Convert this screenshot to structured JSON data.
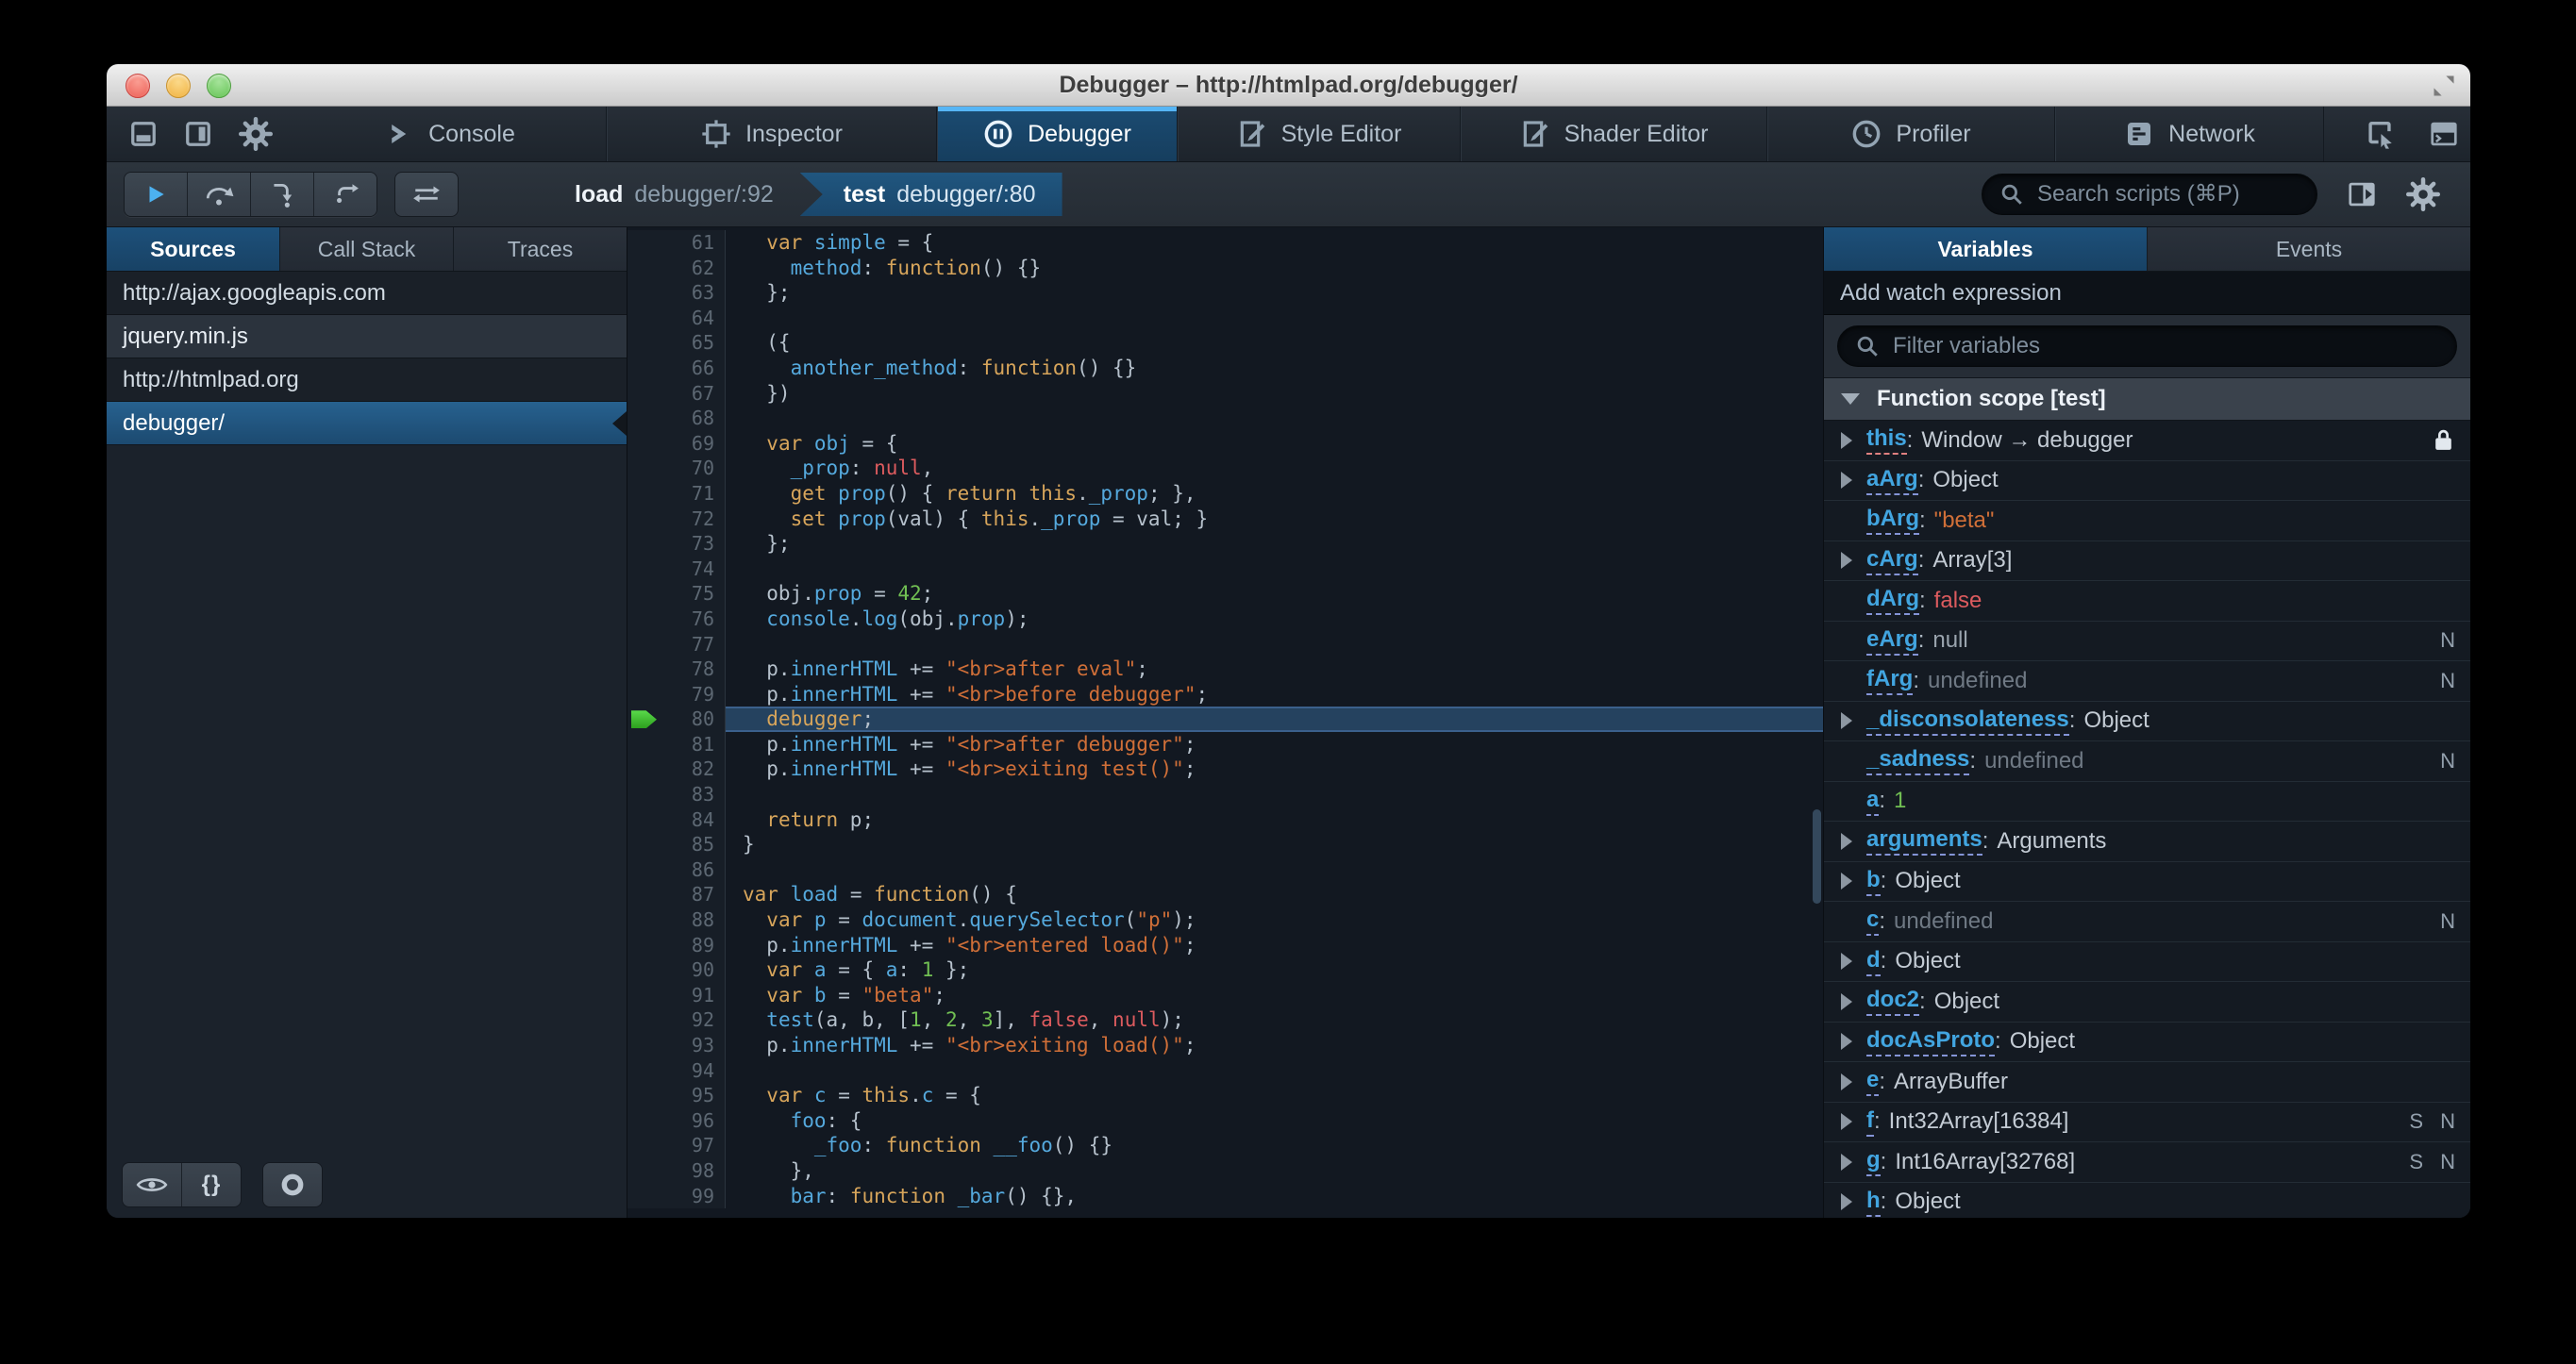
{
  "window": {
    "title": "Debugger – http://htmlpad.org/debugger/"
  },
  "theme": {
    "accent_blue": "#46afe3",
    "selection_blue": "#1d4f73",
    "chrome_dark": "#252c33",
    "editor_bg": "#121821",
    "keyword": "#d7a55b",
    "identifier": "#55a9dd",
    "string": "#d06f38",
    "number": "#71bf53",
    "atom": "#dc5b5e",
    "exec_arrow_green": "#3dbb2d"
  },
  "tabbar": {
    "dock_icons": [
      {
        "icon": "dock-bottom-icon"
      },
      {
        "icon": "dock-side-icon"
      },
      {
        "icon": "toolbox-options-gear-icon"
      }
    ],
    "tabs": [
      {
        "label": "Console",
        "icon": "console-icon",
        "active": false
      },
      {
        "label": "Inspector",
        "icon": "inspector-icon",
        "active": false
      },
      {
        "label": "Debugger",
        "icon": "debugger-icon",
        "active": true
      },
      {
        "label": "Style Editor",
        "icon": "style-editor-icon",
        "active": false
      },
      {
        "label": "Shader Editor",
        "icon": "shader-editor-icon",
        "active": false
      },
      {
        "label": "Profiler",
        "icon": "profiler-icon",
        "active": false
      },
      {
        "label": "Network",
        "icon": "network-icon",
        "active": false
      }
    ],
    "tools": [
      {
        "icon": "element-picker-icon"
      },
      {
        "icon": "split-console-icon"
      },
      {
        "icon": "paintbrush-icon"
      },
      {
        "icon": "tilt-3d-icon"
      },
      {
        "icon": "scratchpad-icon"
      },
      {
        "icon": "responsive-mode-icon"
      }
    ]
  },
  "toolbar": {
    "buttons": [
      {
        "icon": "resume-icon"
      },
      {
        "icon": "step-over-icon"
      },
      {
        "icon": "step-in-icon"
      },
      {
        "icon": "step-out-icon"
      }
    ],
    "toggle_button": {
      "icon": "toggle-pause-exceptions-icon"
    },
    "breadcrumbs": [
      {
        "fn": "load",
        "loc": "debugger/:92",
        "active": false
      },
      {
        "fn": "test",
        "loc": "debugger/:80",
        "active": true
      }
    ],
    "search": {
      "placeholder": "Search scripts (⌘P)"
    }
  },
  "sidebar": {
    "tabs": [
      "Sources",
      "Call Stack",
      "Traces"
    ],
    "active_tab": "Sources",
    "items": [
      {
        "label": "http://ajax.googleapis.com",
        "type": "group",
        "selected": false
      },
      {
        "label": "jquery.min.js",
        "type": "file",
        "selected": false
      },
      {
        "label": "http://htmlpad.org",
        "type": "group",
        "selected": false
      },
      {
        "label": "debugger/",
        "type": "file",
        "selected": true
      }
    ],
    "bottom_buttons": [
      {
        "icon": "blackbox-eye-icon"
      },
      {
        "icon": "prettyprint-braces-icon",
        "text": "{}"
      },
      {
        "icon": "toggle-breakpoints-icon"
      }
    ]
  },
  "editor": {
    "current_line": 80,
    "lines": [
      {
        "n": 61,
        "t": [
          [
            "pl",
            "  "
          ],
          [
            "kw",
            "var"
          ],
          [
            "pl",
            " "
          ],
          [
            "pr",
            "simple"
          ],
          [
            "pl",
            " = {"
          ]
        ]
      },
      {
        "n": 62,
        "t": [
          [
            "pl",
            "    "
          ],
          [
            "pr",
            "method"
          ],
          [
            "pl",
            ": "
          ],
          [
            "kw",
            "function"
          ],
          [
            "pl",
            "() {}"
          ]
        ]
      },
      {
        "n": 63,
        "t": [
          [
            "pl",
            "  };"
          ]
        ]
      },
      {
        "n": 64,
        "t": []
      },
      {
        "n": 65,
        "t": [
          [
            "pl",
            "  ({"
          ]
        ]
      },
      {
        "n": 66,
        "t": [
          [
            "pl",
            "    "
          ],
          [
            "pr",
            "another_method"
          ],
          [
            "pl",
            ": "
          ],
          [
            "kw",
            "function"
          ],
          [
            "pl",
            "() {}"
          ]
        ]
      },
      {
        "n": 67,
        "t": [
          [
            "pl",
            "  })"
          ]
        ]
      },
      {
        "n": 68,
        "t": []
      },
      {
        "n": 69,
        "t": [
          [
            "pl",
            "  "
          ],
          [
            "kw",
            "var"
          ],
          [
            "pl",
            " "
          ],
          [
            "pr",
            "obj"
          ],
          [
            "pl",
            " = {"
          ]
        ]
      },
      {
        "n": 70,
        "t": [
          [
            "pl",
            "    "
          ],
          [
            "pr",
            "_prop"
          ],
          [
            "pl",
            ": "
          ],
          [
            "at",
            "null"
          ],
          [
            "pl",
            ","
          ]
        ]
      },
      {
        "n": 71,
        "t": [
          [
            "pl",
            "    "
          ],
          [
            "kw",
            "get"
          ],
          [
            "pl",
            " "
          ],
          [
            "pr",
            "prop"
          ],
          [
            "pl",
            "() { "
          ],
          [
            "kw",
            "return"
          ],
          [
            "pl",
            " "
          ],
          [
            "kw",
            "this"
          ],
          [
            "pl",
            "."
          ],
          [
            "pr",
            "_prop"
          ],
          [
            "pl",
            "; },"
          ]
        ]
      },
      {
        "n": 72,
        "t": [
          [
            "pl",
            "    "
          ],
          [
            "kw",
            "set"
          ],
          [
            "pl",
            " "
          ],
          [
            "pr",
            "prop"
          ],
          [
            "pl",
            "(val) { "
          ],
          [
            "kw",
            "this"
          ],
          [
            "pl",
            "."
          ],
          [
            "pr",
            "_prop"
          ],
          [
            "pl",
            " = val; }"
          ]
        ]
      },
      {
        "n": 73,
        "t": [
          [
            "pl",
            "  };"
          ]
        ]
      },
      {
        "n": 74,
        "t": []
      },
      {
        "n": 75,
        "t": [
          [
            "pl",
            "  obj."
          ],
          [
            "pr",
            "prop"
          ],
          [
            "pl",
            " = "
          ],
          [
            "nu",
            "42"
          ],
          [
            "pl",
            ";"
          ]
        ]
      },
      {
        "n": 76,
        "t": [
          [
            "pl",
            "  "
          ],
          [
            "pr",
            "console"
          ],
          [
            "pl",
            "."
          ],
          [
            "pr",
            "log"
          ],
          [
            "pl",
            "(obj."
          ],
          [
            "pr",
            "prop"
          ],
          [
            "pl",
            ");"
          ]
        ]
      },
      {
        "n": 77,
        "t": []
      },
      {
        "n": 78,
        "t": [
          [
            "pl",
            "  p."
          ],
          [
            "pr",
            "innerHTML"
          ],
          [
            "pl",
            " += "
          ],
          [
            "st",
            "\"<br>after eval\""
          ],
          [
            "pl",
            ";"
          ]
        ]
      },
      {
        "n": 79,
        "t": [
          [
            "pl",
            "  p."
          ],
          [
            "pr",
            "innerHTML"
          ],
          [
            "pl",
            " += "
          ],
          [
            "st",
            "\"<br>before debugger\""
          ],
          [
            "pl",
            ";"
          ]
        ]
      },
      {
        "n": 80,
        "t": [
          [
            "pl",
            "  "
          ],
          [
            "kw",
            "debugger"
          ],
          [
            "pl",
            ";"
          ]
        ]
      },
      {
        "n": 81,
        "t": [
          [
            "pl",
            "  p."
          ],
          [
            "pr",
            "innerHTML"
          ],
          [
            "pl",
            " += "
          ],
          [
            "st",
            "\"<br>after debugger\""
          ],
          [
            "pl",
            ";"
          ]
        ]
      },
      {
        "n": 82,
        "t": [
          [
            "pl",
            "  p."
          ],
          [
            "pr",
            "innerHTML"
          ],
          [
            "pl",
            " += "
          ],
          [
            "st",
            "\"<br>exiting test()\""
          ],
          [
            "pl",
            ";"
          ]
        ]
      },
      {
        "n": 83,
        "t": []
      },
      {
        "n": 84,
        "t": [
          [
            "pl",
            "  "
          ],
          [
            "kw",
            "return"
          ],
          [
            "pl",
            " p;"
          ]
        ]
      },
      {
        "n": 85,
        "t": [
          [
            "pl",
            "}"
          ]
        ]
      },
      {
        "n": 86,
        "t": []
      },
      {
        "n": 87,
        "t": [
          [
            "kw",
            "var"
          ],
          [
            "pl",
            " "
          ],
          [
            "pr",
            "load"
          ],
          [
            "pl",
            " = "
          ],
          [
            "kw",
            "function"
          ],
          [
            "pl",
            "() {"
          ]
        ]
      },
      {
        "n": 88,
        "t": [
          [
            "pl",
            "  "
          ],
          [
            "kw",
            "var"
          ],
          [
            "pl",
            " "
          ],
          [
            "pr",
            "p"
          ],
          [
            "pl",
            " = "
          ],
          [
            "pr",
            "document"
          ],
          [
            "pl",
            "."
          ],
          [
            "pr",
            "querySelector"
          ],
          [
            "pl",
            "("
          ],
          [
            "st",
            "\"p\""
          ],
          [
            "pl",
            ");"
          ]
        ]
      },
      {
        "n": 89,
        "t": [
          [
            "pl",
            "  p."
          ],
          [
            "pr",
            "innerHTML"
          ],
          [
            "pl",
            " += "
          ],
          [
            "st",
            "\"<br>entered load()\""
          ],
          [
            "pl",
            ";"
          ]
        ]
      },
      {
        "n": 90,
        "t": [
          [
            "pl",
            "  "
          ],
          [
            "kw",
            "var"
          ],
          [
            "pl",
            " "
          ],
          [
            "pr",
            "a"
          ],
          [
            "pl",
            " = { "
          ],
          [
            "pr",
            "a"
          ],
          [
            "pl",
            ": "
          ],
          [
            "nu",
            "1"
          ],
          [
            "pl",
            " };"
          ]
        ]
      },
      {
        "n": 91,
        "t": [
          [
            "pl",
            "  "
          ],
          [
            "kw",
            "var"
          ],
          [
            "pl",
            " "
          ],
          [
            "pr",
            "b"
          ],
          [
            "pl",
            " = "
          ],
          [
            "st",
            "\"beta\""
          ],
          [
            "pl",
            ";"
          ]
        ]
      },
      {
        "n": 92,
        "t": [
          [
            "pl",
            "  "
          ],
          [
            "pr",
            "test"
          ],
          [
            "pl",
            "(a, b, ["
          ],
          [
            "nu",
            "1"
          ],
          [
            "pl",
            ", "
          ],
          [
            "nu",
            "2"
          ],
          [
            "pl",
            ", "
          ],
          [
            "nu",
            "3"
          ],
          [
            "pl",
            "], "
          ],
          [
            "at",
            "false"
          ],
          [
            "pl",
            ", "
          ],
          [
            "at",
            "null"
          ],
          [
            "pl",
            ");"
          ]
        ]
      },
      {
        "n": 93,
        "t": [
          [
            "pl",
            "  p."
          ],
          [
            "pr",
            "innerHTML"
          ],
          [
            "pl",
            " += "
          ],
          [
            "st",
            "\"<br>exiting load()\""
          ],
          [
            "pl",
            ";"
          ]
        ]
      },
      {
        "n": 94,
        "t": []
      },
      {
        "n": 95,
        "t": [
          [
            "pl",
            "  "
          ],
          [
            "kw",
            "var"
          ],
          [
            "pl",
            " "
          ],
          [
            "pr",
            "c"
          ],
          [
            "pl",
            " = "
          ],
          [
            "kw",
            "this"
          ],
          [
            "pl",
            "."
          ],
          [
            "pr",
            "c"
          ],
          [
            "pl",
            " = {"
          ]
        ]
      },
      {
        "n": 96,
        "t": [
          [
            "pl",
            "    "
          ],
          [
            "pr",
            "foo"
          ],
          [
            "pl",
            ": {"
          ]
        ]
      },
      {
        "n": 97,
        "t": [
          [
            "pl",
            "      "
          ],
          [
            "pr",
            "_foo"
          ],
          [
            "pl",
            ": "
          ],
          [
            "kw",
            "function"
          ],
          [
            "pl",
            " "
          ],
          [
            "pr",
            "__foo"
          ],
          [
            "pl",
            "() {}"
          ]
        ]
      },
      {
        "n": 98,
        "t": [
          [
            "pl",
            "    },"
          ]
        ]
      },
      {
        "n": 99,
        "t": [
          [
            "pl",
            "    "
          ],
          [
            "pr",
            "bar"
          ],
          [
            "pl",
            ": "
          ],
          [
            "kw",
            "function"
          ],
          [
            "pl",
            " "
          ],
          [
            "pr",
            "_bar"
          ],
          [
            "pl",
            "() {},"
          ]
        ]
      }
    ]
  },
  "variables_panel": {
    "tabs": [
      "Variables",
      "Events"
    ],
    "active_tab": "Variables",
    "watch_label": "Add watch expression",
    "filter_placeholder": "Filter variables",
    "scope_label": "Function scope [test]",
    "rows": [
      {
        "name": "this",
        "value": "Window → debugger",
        "vtype": "obj",
        "expand": true,
        "lock": true,
        "underline": "this",
        "badges": []
      },
      {
        "name": "aArg",
        "value": "Object",
        "vtype": "obj",
        "expand": true,
        "badges": []
      },
      {
        "name": "bArg",
        "value": "\"beta\"",
        "vtype": "str",
        "expand": false,
        "badges": []
      },
      {
        "name": "cArg",
        "value": "Array[3]",
        "vtype": "obj",
        "expand": true,
        "badges": []
      },
      {
        "name": "dArg",
        "value": "false",
        "vtype": "bool",
        "expand": false,
        "badges": []
      },
      {
        "name": "eArg",
        "value": "null",
        "vtype": "null",
        "expand": false,
        "badges": [
          "N"
        ]
      },
      {
        "name": "fArg",
        "value": "undefined",
        "vtype": "undef",
        "expand": false,
        "badges": [
          "N"
        ]
      },
      {
        "name": "_disconsolateness",
        "value": "Object",
        "vtype": "obj",
        "expand": true,
        "badges": []
      },
      {
        "name": "_sadness",
        "value": "undefined",
        "vtype": "undef",
        "expand": false,
        "badges": [
          "N"
        ]
      },
      {
        "name": "a",
        "value": "1",
        "vtype": "num",
        "expand": false,
        "badges": []
      },
      {
        "name": "arguments",
        "value": "Arguments",
        "vtype": "obj",
        "expand": true,
        "badges": []
      },
      {
        "name": "b",
        "value": "Object",
        "vtype": "obj",
        "expand": true,
        "badges": []
      },
      {
        "name": "c",
        "value": "undefined",
        "vtype": "undef",
        "expand": false,
        "badges": [
          "N"
        ]
      },
      {
        "name": "d",
        "value": "Object",
        "vtype": "obj",
        "expand": true,
        "badges": []
      },
      {
        "name": "doc2",
        "value": "Object",
        "vtype": "obj",
        "expand": true,
        "badges": []
      },
      {
        "name": "docAsProto",
        "value": "Object",
        "vtype": "obj",
        "expand": true,
        "badges": []
      },
      {
        "name": "e",
        "value": "ArrayBuffer",
        "vtype": "obj",
        "expand": true,
        "badges": []
      },
      {
        "name": "f",
        "value": "Int32Array[16384]",
        "vtype": "obj",
        "expand": true,
        "badges": [
          "S",
          "N"
        ]
      },
      {
        "name": "g",
        "value": "Int16Array[32768]",
        "vtype": "obj",
        "expand": true,
        "badges": [
          "S",
          "N"
        ]
      },
      {
        "name": "h",
        "value": "Object",
        "vtype": "obj",
        "expand": true,
        "badges": []
      }
    ]
  }
}
